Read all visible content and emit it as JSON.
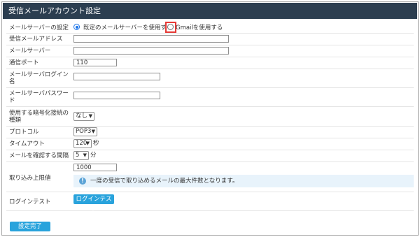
{
  "header": {
    "title": "受信メールアカウント設定"
  },
  "mail_server": {
    "label": "メールサーバーの設定",
    "option_default": "既定のメールサーバーを使用する",
    "option_gmail": "Gmailを使用する",
    "selected": "default"
  },
  "receive_address": {
    "label": "受信メールアドレス",
    "value": ""
  },
  "server": {
    "label": "メールサーバー",
    "value": ""
  },
  "port": {
    "label": "通信ポート",
    "value": "110"
  },
  "login": {
    "label": "メールサーバログイン名",
    "value": ""
  },
  "password": {
    "label": "メールサーバパスワード",
    "value": ""
  },
  "encryption": {
    "label": "使用する暗号化接続の種類",
    "value": "なし"
  },
  "protocol": {
    "label": "プロトコル",
    "value": "POP3"
  },
  "timeout": {
    "label": "タイムアウト",
    "value": "120",
    "unit": "秒"
  },
  "interval": {
    "label": "メールを確認する間隔",
    "value": "5",
    "unit": "分"
  },
  "fetch_limit": {
    "label": "取り込み上限値",
    "value": "1000",
    "info": "一度の受信で取り込めるメールの最大件数となります。"
  },
  "login_test": {
    "label": "ログインテスト",
    "button": "ログインテスト"
  },
  "submit": {
    "label": "設定完了"
  },
  "icons": {
    "arrow": "chevron-down-icon",
    "info": "info-icon"
  }
}
